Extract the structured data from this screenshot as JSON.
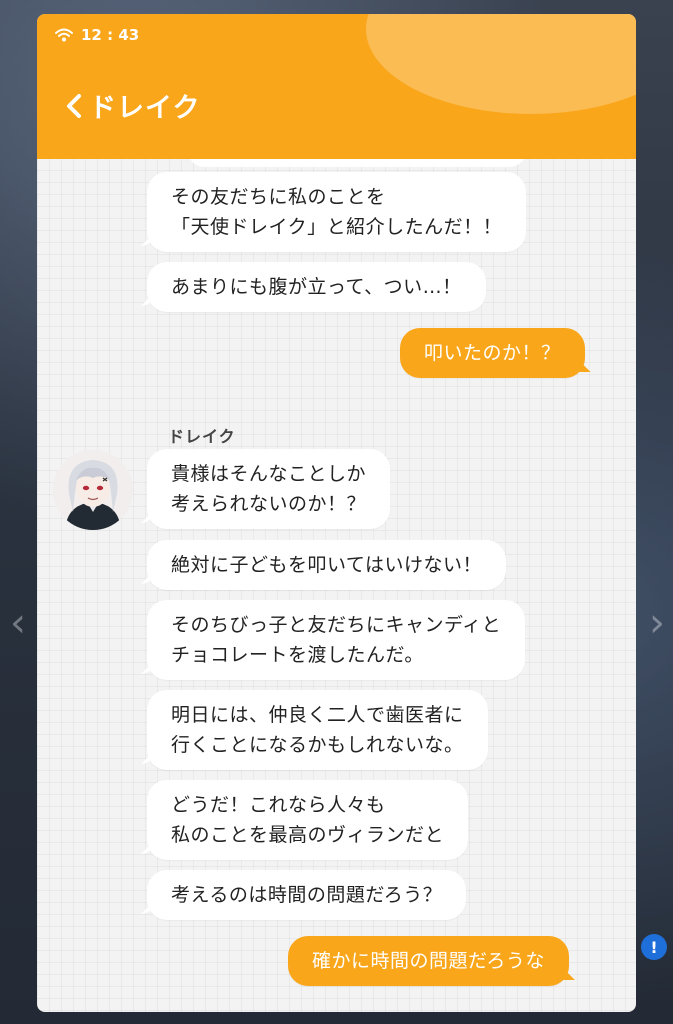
{
  "status_bar": {
    "time": "12 : 43"
  },
  "header": {
    "title": "ドレイク"
  },
  "chat": {
    "sender_name": "ドレイク",
    "messages": [
      {
        "side": "left",
        "text": "その友だちに私のことを\n「天使ドレイク」と紹介したんだ！！"
      },
      {
        "side": "left",
        "text": "あまりにも腹が立って、つい…！"
      },
      {
        "side": "right",
        "text": "叩いたのか！？"
      },
      {
        "side": "left",
        "text": "貴様はそんなことしか\n考えられないのか！？"
      },
      {
        "side": "left",
        "text": "絶対に子どもを叩いてはいけない！"
      },
      {
        "side": "left",
        "text": "そのちびっ子と友だちにキャンディと\nチョコレートを渡したんだ。"
      },
      {
        "side": "left",
        "text": "明日には、仲良く二人で歯医者に\n行くことになるかもしれないな。"
      },
      {
        "side": "left",
        "text": "どうだ！これなら人々も\n私のことを最高のヴィランだと"
      },
      {
        "side": "left",
        "text": "考えるのは時間の問題だろう？"
      },
      {
        "side": "right",
        "text": "確かに時間の問題だろうな"
      }
    ]
  },
  "colors": {
    "accent": "#f9a61a",
    "bubble": "#ffffff",
    "chat_bg": "#f3f3f3"
  },
  "icons": [
    "wifi-icon",
    "back-chevron-icon",
    "avatar-drake"
  ]
}
